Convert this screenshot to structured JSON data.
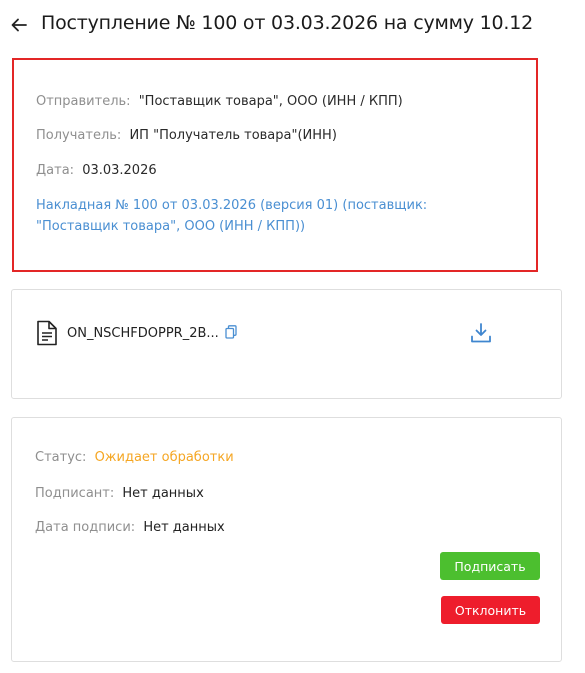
{
  "header": {
    "back_icon": "arrow-left-icon",
    "title": "Поступление № 100 от 03.03.2026 на сумму 10.12"
  },
  "info": {
    "sender_label": "Отправитель:",
    "sender_value": "\"Поставщик товара\", ООО (ИНН / КПП)",
    "receiver_label": "Получатель:",
    "receiver_value": "ИП \"Получатель товара\"(ИНН)",
    "date_label": "Дата:",
    "date_value": "03.03.2026",
    "invoice_link": "Накладная № 100 от 03.03.2026 (версия 01) (поставщик: \"Поставщик товара\", ООО (ИНН / КПП))",
    "highlight_color": "#e32626",
    "link_color": "#4a8fd2"
  },
  "file": {
    "name": "ON_NSCHFDOPPR_2B...",
    "doc_icon": "document-icon",
    "copy_icon": "copy-icon",
    "download_icon": "download-icon"
  },
  "status": {
    "status_label": "Статус:",
    "status_value": "Ожидает обработки",
    "status_color": "#f5a623",
    "signer_label": "Подписант:",
    "signer_value": "Нет данных",
    "sign_date_label": "Дата подписи:",
    "sign_date_value": "Нет данных",
    "sign_button": "Подписать",
    "reject_button": "Отклонить",
    "sign_color": "#4cbf2f",
    "reject_color": "#ee1d2c"
  }
}
